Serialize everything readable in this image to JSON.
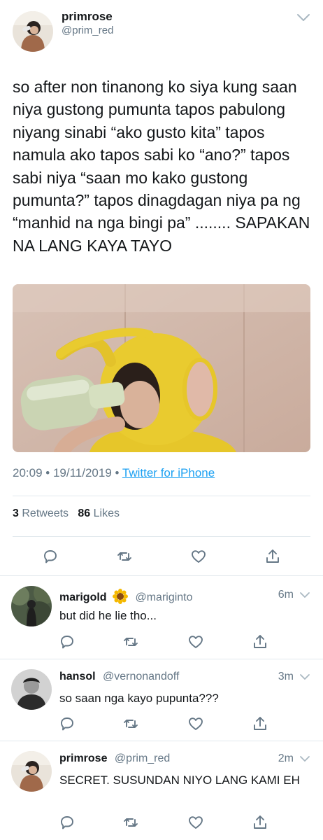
{
  "tweet": {
    "author_name": "primrose",
    "author_handle": "@prim_red",
    "text": "so after non tinanong ko siya kung saan niya gustong pumunta tapos pabulong niyang sinabi “ako gusto kita” tapos namula ako tapos sabi ko “ano?” tapos sabi niya “saan mo kako gustong pumunta?” tapos dinagdagan niya pa ng “manhid na nga bingi pa” ........ SAPAKAN NA LANG KAYA TAYO",
    "time": "20:09",
    "date": "19/11/2019",
    "separator": "•",
    "source": "Twitter for iPhone",
    "retweets_count": "3",
    "retweets_label": "Retweets",
    "likes_count": "86",
    "likes_label": "Likes"
  },
  "replies": [
    {
      "name": "marigold",
      "emoji": "sunflower-emoji",
      "handle": "@mariginto",
      "time": "6m",
      "text": "but did he lie tho..."
    },
    {
      "name": "hansol",
      "handle": "@vernonandoff",
      "time": "3m",
      "text": "so saan nga kayo pupunta???"
    },
    {
      "name": "primrose",
      "handle": "@prim_red",
      "time": "2m",
      "text": "SECRET. SUSUNDAN NIYO LANG KAMI EH"
    }
  ],
  "icons": {
    "reply": "reply-icon",
    "retweet": "retweet-icon",
    "like": "heart-icon",
    "share": "share-icon",
    "more": "chevron-down-icon"
  },
  "colors": {
    "link": "#1da1f2",
    "secondary_text": "#657786",
    "icon": "#657786",
    "divider": "#e1e8ed"
  }
}
